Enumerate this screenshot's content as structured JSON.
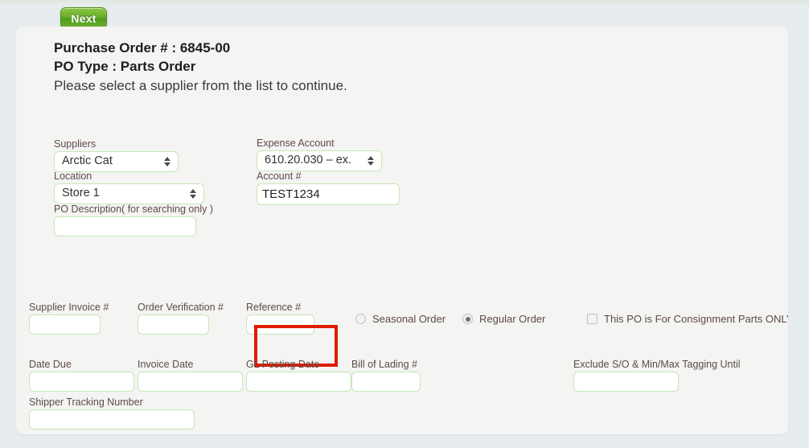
{
  "toolbar": {
    "next_label": "Next"
  },
  "header": {
    "po_number": "Purchase Order # : 6845-00",
    "po_type": "PO Type : Parts Order",
    "instruction": "Please select a supplier from the list to continue."
  },
  "form": {
    "suppliers": {
      "label": "Suppliers",
      "value": "Arctic Cat"
    },
    "location": {
      "label": "Location",
      "value": "Store 1"
    },
    "po_description": {
      "label": "PO Description( for searching only )",
      "value": ""
    },
    "expense_account": {
      "label": "Expense Account",
      "value": "610.20.030 – ex."
    },
    "account_number": {
      "label": "Account #",
      "value": "TEST1234"
    },
    "supplier_invoice": {
      "label": "Supplier Invoice #",
      "value": ""
    },
    "order_verification": {
      "label": "Order Verification #",
      "value": ""
    },
    "reference": {
      "label": "Reference #",
      "value": ""
    },
    "date_due": {
      "label": "Date Due",
      "value": ""
    },
    "invoice_date": {
      "label": "Invoice Date",
      "value": ""
    },
    "gl_posting_date": {
      "label": "GL Posting Date",
      "value": ""
    },
    "bill_of_lading": {
      "label": "Bill of Lading #",
      "value": ""
    },
    "exclude_tagging": {
      "label": "Exclude S/O & Min/Max Tagging Until",
      "value": ""
    },
    "shipper_tracking": {
      "label": "Shipper Tracking Number",
      "value": ""
    }
  },
  "order_type": {
    "seasonal_label": "Seasonal Order",
    "regular_label": "Regular Order",
    "selected": "Regular Order"
  },
  "consignment": {
    "label": "This PO is For Consignment Parts ONLY",
    "checked": false
  },
  "colors": {
    "page_background": "#e7ecee",
    "panel_background": "#f4f4f2",
    "input_border": "#c6e7b6",
    "button_green": "#69ad2c",
    "highlight_red": "#e01b00",
    "label_text": "#5c4b4b"
  }
}
